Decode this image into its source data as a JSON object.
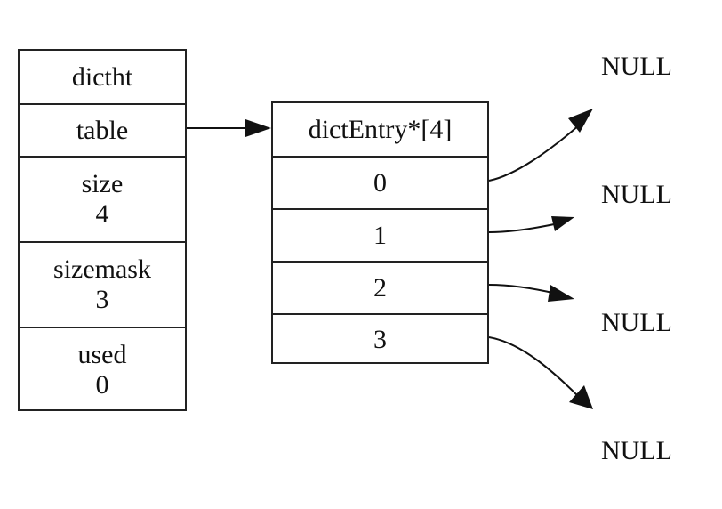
{
  "dictht": {
    "title": "dictht",
    "fields": [
      {
        "name": "table",
        "value": null
      },
      {
        "name": "size",
        "value": "4"
      },
      {
        "name": "sizemask",
        "value": "3"
      },
      {
        "name": "used",
        "value": "0"
      }
    ]
  },
  "table_array": {
    "title": "dictEntry*[4]",
    "slots": [
      "0",
      "1",
      "2",
      "3"
    ]
  },
  "null_labels": [
    "NULL",
    "NULL",
    "NULL",
    "NULL"
  ],
  "edges": [
    {
      "from": "dictht.table",
      "to": "dictEntry*[4]"
    },
    {
      "from": "slot-0",
      "to": "NULL"
    },
    {
      "from": "slot-1",
      "to": "NULL"
    },
    {
      "from": "slot-2",
      "to": "NULL"
    },
    {
      "from": "slot-3",
      "to": "NULL"
    }
  ]
}
